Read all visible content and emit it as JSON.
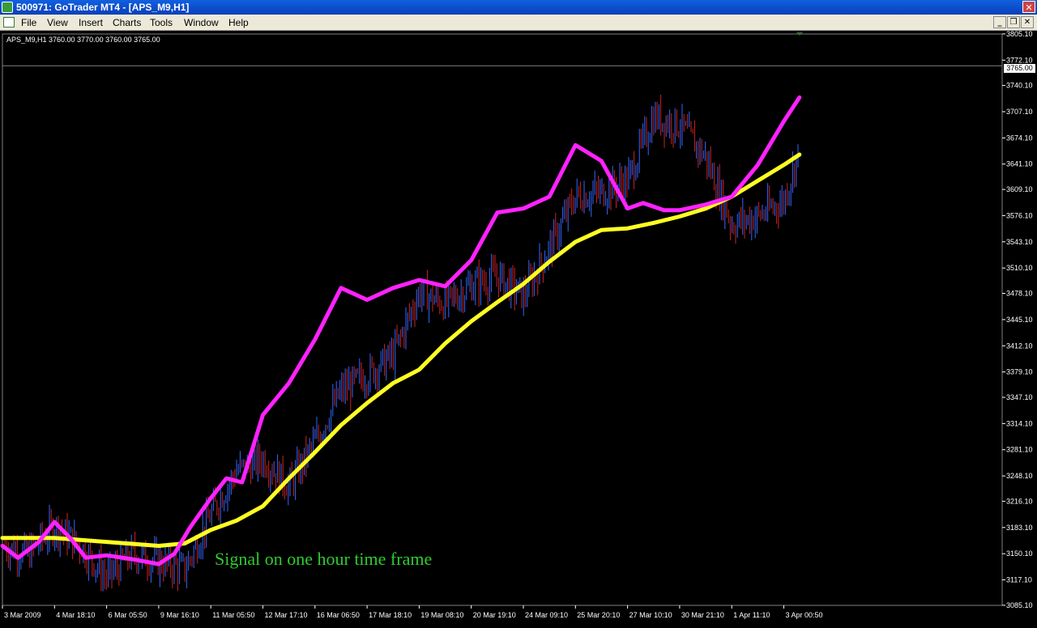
{
  "window": {
    "title": "500971: GoTrader MT4 - [APS_M9,H1]",
    "close_icon": "close-icon"
  },
  "menu": {
    "items": [
      "File",
      "View",
      "Insert",
      "Charts",
      "Tools",
      "Window",
      "Help"
    ],
    "controls": [
      "minimize",
      "restore",
      "close"
    ]
  },
  "chart_info": {
    "symbol_line": "APS_M9,H1  3760.00 3770.00 3760.00 3765.00",
    "current_price": "3765.00",
    "annotation": "Signal on one hour time frame"
  },
  "colors": {
    "background": "#000000",
    "bull_candle": "#3366ff",
    "bear_candle": "#cc2222",
    "fast_ma": "#ff22ff",
    "slow_ma": "#ffff22",
    "annotation": "#2ecc2e",
    "price_line": "#808080"
  },
  "chart_data": {
    "type": "line",
    "title": "",
    "xlabel": "",
    "ylabel": "",
    "ylim": [
      3085.0,
      3805.0
    ],
    "y_ticks": [
      "3805.10",
      "3772.10",
      "3740.10",
      "3707.10",
      "3674.10",
      "3641.10",
      "3609.10",
      "3576.10",
      "3543.10",
      "3510.10",
      "3478.10",
      "3445.10",
      "3412.10",
      "3379.10",
      "3347.10",
      "3314.10",
      "3281.10",
      "3248.10",
      "3216.10",
      "3183.10",
      "3150.10",
      "3117.10",
      "3085.10"
    ],
    "x_ticks": [
      "3 Mar 2009",
      "4 Mar 18:10",
      "6 Mar 05:50",
      "9 Mar 16:10",
      "11 Mar 05:50",
      "12 Mar 17:10",
      "16 Mar 06:50",
      "17 Mar 18:10",
      "19 Mar 08:10",
      "20 Mar 19:10",
      "24 Mar 09:10",
      "25 Mar 20:10",
      "27 Mar 10:10",
      "30 Mar 21:10",
      "1 Apr 11:10",
      "3 Apr 00:50"
    ],
    "grid": false,
    "series": [
      {
        "name": "",
        "style": "close",
        "x": [
          0,
          0.5,
          1,
          1.5,
          2,
          2.5,
          3,
          3.5,
          4,
          4.5,
          5,
          5.5,
          6,
          6.5,
          7,
          7.5,
          8,
          8.5,
          9,
          9.5,
          10,
          10.5,
          11,
          11.5,
          12,
          12.5,
          13,
          13.5,
          14,
          14.5,
          15,
          15.3
        ],
        "values": [
          3160,
          3150,
          3185,
          3160,
          3120,
          3150,
          3140,
          3130,
          3200,
          3255,
          3270,
          3235,
          3290,
          3355,
          3375,
          3400,
          3480,
          3465,
          3488,
          3500,
          3475,
          3535,
          3600,
          3605,
          3620,
          3700,
          3690,
          3650,
          3565,
          3575,
          3595,
          3660
        ]
      },
      {
        "name": "",
        "style": "fast_ma",
        "x": [
          0,
          0.3,
          0.7,
          1,
          1.3,
          1.6,
          2,
          2.5,
          3,
          3.3,
          3.6,
          4,
          4.3,
          4.6,
          5,
          5.5,
          6,
          6.5,
          7,
          7.5,
          8,
          8.5,
          9,
          9.5,
          10,
          10.5,
          11,
          11.5,
          12,
          12.3,
          12.7,
          13,
          13.5,
          14,
          14.5,
          15,
          15.3
        ],
        "values": [
          3160,
          3145,
          3165,
          3190,
          3170,
          3145,
          3148,
          3143,
          3137,
          3150,
          3183,
          3220,
          3245,
          3240,
          3325,
          3365,
          3420,
          3485,
          3470,
          3485,
          3495,
          3487,
          3520,
          3580,
          3585,
          3600,
          3665,
          3645,
          3585,
          3592,
          3583,
          3583,
          3590,
          3600,
          3640,
          3695,
          3725
        ]
      },
      {
        "name": "",
        "style": "slow_ma",
        "x": [
          0,
          1,
          2,
          3,
          3.5,
          4,
          4.5,
          5,
          5.5,
          6,
          6.5,
          7,
          7.5,
          8,
          8.5,
          9,
          9.5,
          10,
          10.5,
          11,
          11.5,
          12,
          12.5,
          13,
          13.5,
          14,
          14.5,
          15,
          15.3
        ],
        "values": [
          3170,
          3170,
          3165,
          3160,
          3163,
          3180,
          3192,
          3210,
          3245,
          3278,
          3312,
          3340,
          3365,
          3382,
          3415,
          3443,
          3467,
          3490,
          3518,
          3543,
          3558,
          3560,
          3567,
          3575,
          3585,
          3600,
          3620,
          3640,
          3653
        ]
      }
    ]
  }
}
